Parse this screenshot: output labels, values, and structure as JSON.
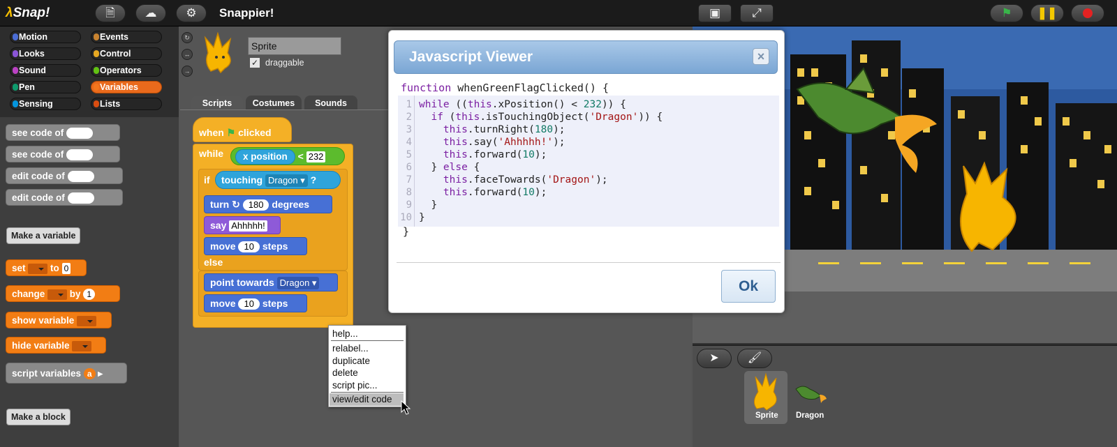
{
  "app": {
    "logo": "Snap!",
    "title": "Snappier!"
  },
  "categories": [
    {
      "label": "Motion",
      "color": "#4a6cd4"
    },
    {
      "label": "Events",
      "color": "#c88330"
    },
    {
      "label": "Looks",
      "color": "#8a55d7"
    },
    {
      "label": "Control",
      "color": "#e6a822"
    },
    {
      "label": "Sound",
      "color": "#bb42c3"
    },
    {
      "label": "Operators",
      "color": "#62c213"
    },
    {
      "label": "Pen",
      "color": "#0e9a6c"
    },
    {
      "label": "Variables",
      "color": "#f3761d"
    },
    {
      "label": "Sensing",
      "color": "#0494dc"
    },
    {
      "label": "Lists",
      "color": "#d94d11"
    }
  ],
  "palette": {
    "code_blocks": [
      "see code of",
      "see code of",
      "edit code of",
      "edit code of"
    ],
    "make_variable": "Make a variable",
    "set": "set",
    "to": "to",
    "set_value": "0",
    "change": "change",
    "by": "by",
    "change_value": "1",
    "show_variable": "show variable",
    "hide_variable": "hide variable",
    "script_variables": "script variables",
    "script_var": "a",
    "make_block": "Make a block"
  },
  "sprite": {
    "name": "Sprite",
    "draggable_label": "draggable",
    "draggable": true
  },
  "tabs": [
    "Scripts",
    "Costumes",
    "Sounds"
  ],
  "script": {
    "when": "when",
    "clicked": "clicked",
    "while": "while",
    "x_position": "x position",
    "lt": "<",
    "limit": "232",
    "if": "if",
    "touching": "touching",
    "target": "Dragon",
    "q": "?",
    "turn": "turn",
    "turn_value": "180",
    "degrees": "degrees",
    "say": "say",
    "say_value": "Ahhhhh!",
    "move": "move",
    "move_value": "10",
    "steps": "steps",
    "else": "else",
    "point_towards": "point towards",
    "point_target": "Dragon"
  },
  "dialog": {
    "title": "Javascript Viewer",
    "close": "×",
    "header": "function whenGreenFlagClicked() {",
    "line_numbers": [
      "1",
      "2",
      "3",
      "4",
      "5",
      "6",
      "7",
      "8",
      "9",
      "10"
    ],
    "footer": "}",
    "ok": "Ok"
  },
  "context_menu": {
    "help": "help...",
    "relabel": "relabel...",
    "duplicate": "duplicate",
    "delete": "delete",
    "script_pic": "script pic...",
    "view_edit": "view/edit code"
  },
  "corral": {
    "sprites": [
      "Sprite",
      "Dragon"
    ]
  },
  "colors": {
    "accent": "#f3761d",
    "dialog_title": "#7aa6d4",
    "go": "#39b54a",
    "stop": "#e52222"
  }
}
